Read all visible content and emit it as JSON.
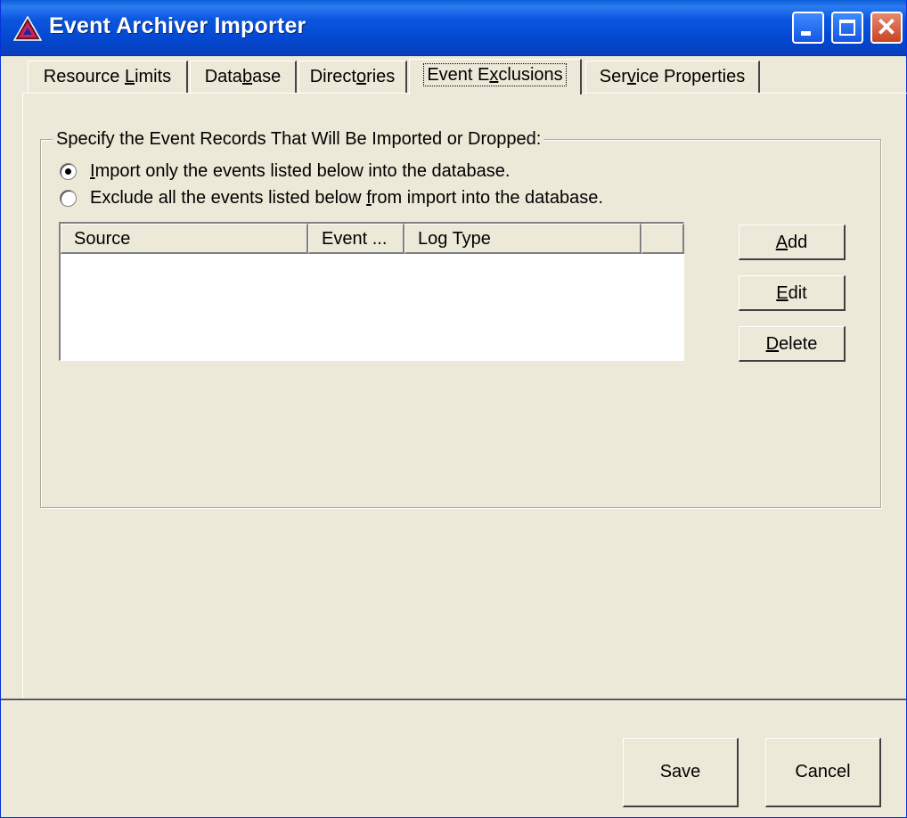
{
  "window": {
    "title": "Event Archiver Importer",
    "controls": {
      "minimize_icon": "minimize-icon",
      "maximize_icon": "maximize-icon",
      "close_icon": "close-icon"
    },
    "close_glyph": "✕"
  },
  "tabs": [
    {
      "pre": "Resource ",
      "key": "L",
      "post": "imits"
    },
    {
      "pre": "Data",
      "key": "b",
      "post": "ase"
    },
    {
      "pre": "Direct",
      "key": "o",
      "post": "ries"
    },
    {
      "pre": "Event E",
      "key": "x",
      "post": "clusions"
    },
    {
      "pre": "Ser",
      "key": "v",
      "post": "ice Properties"
    }
  ],
  "active_tab": "Event Exclusions",
  "group": {
    "label": "Specify the Event Records That Will Be Imported or Dropped:",
    "radio_import": {
      "pre": "",
      "key": "I",
      "post": "mport only the events listed below into the database.",
      "checked": true
    },
    "radio_exclude": {
      "pre": "Exclude all the events listed below ",
      "key": "f",
      "post": "rom import into the database.",
      "checked": false
    }
  },
  "listview": {
    "columns": [
      "Source",
      "Event ...",
      "Log Type",
      ""
    ],
    "rows": []
  },
  "side_buttons": {
    "add": {
      "pre": "",
      "key": "A",
      "post": "dd"
    },
    "edit": {
      "pre": "",
      "key": "E",
      "post": "dit"
    },
    "delete": {
      "pre": "",
      "key": "D",
      "post": "elete"
    }
  },
  "footer": {
    "save_label": "Save",
    "cancel_label": "Cancel"
  }
}
